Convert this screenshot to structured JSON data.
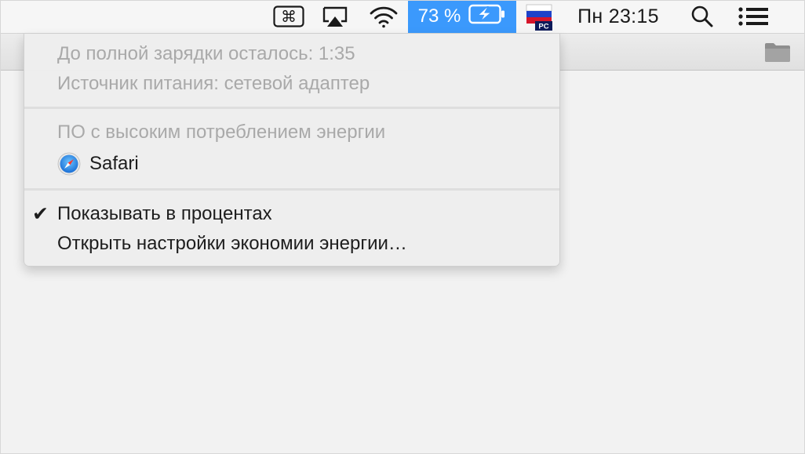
{
  "menubar": {
    "battery_percent": "73 %",
    "clock": "Пн 23:15",
    "input_source_badge": "PC",
    "icons": {
      "keyboard": "command-key-icon",
      "airplay": "airplay-icon",
      "wifi": "wifi-icon",
      "battery": "battery-charging-icon",
      "flag": "russian-flag-icon",
      "search": "spotlight-search-icon",
      "notifications": "notification-center-icon"
    },
    "accent_color": "#3b99fc"
  },
  "menu": {
    "time_remaining": "До полной зарядки осталось: 1:35",
    "power_source": "Источник питания: сетевой адаптер",
    "high_energy_header": "ПО с высоким потреблением энергии",
    "apps": [
      {
        "label": "Safari",
        "icon": "safari-compass-icon"
      }
    ],
    "show_percentage": {
      "label": "Показывать в процентах",
      "checked": true
    },
    "open_settings": "Открыть настройки экономии энергии…"
  }
}
